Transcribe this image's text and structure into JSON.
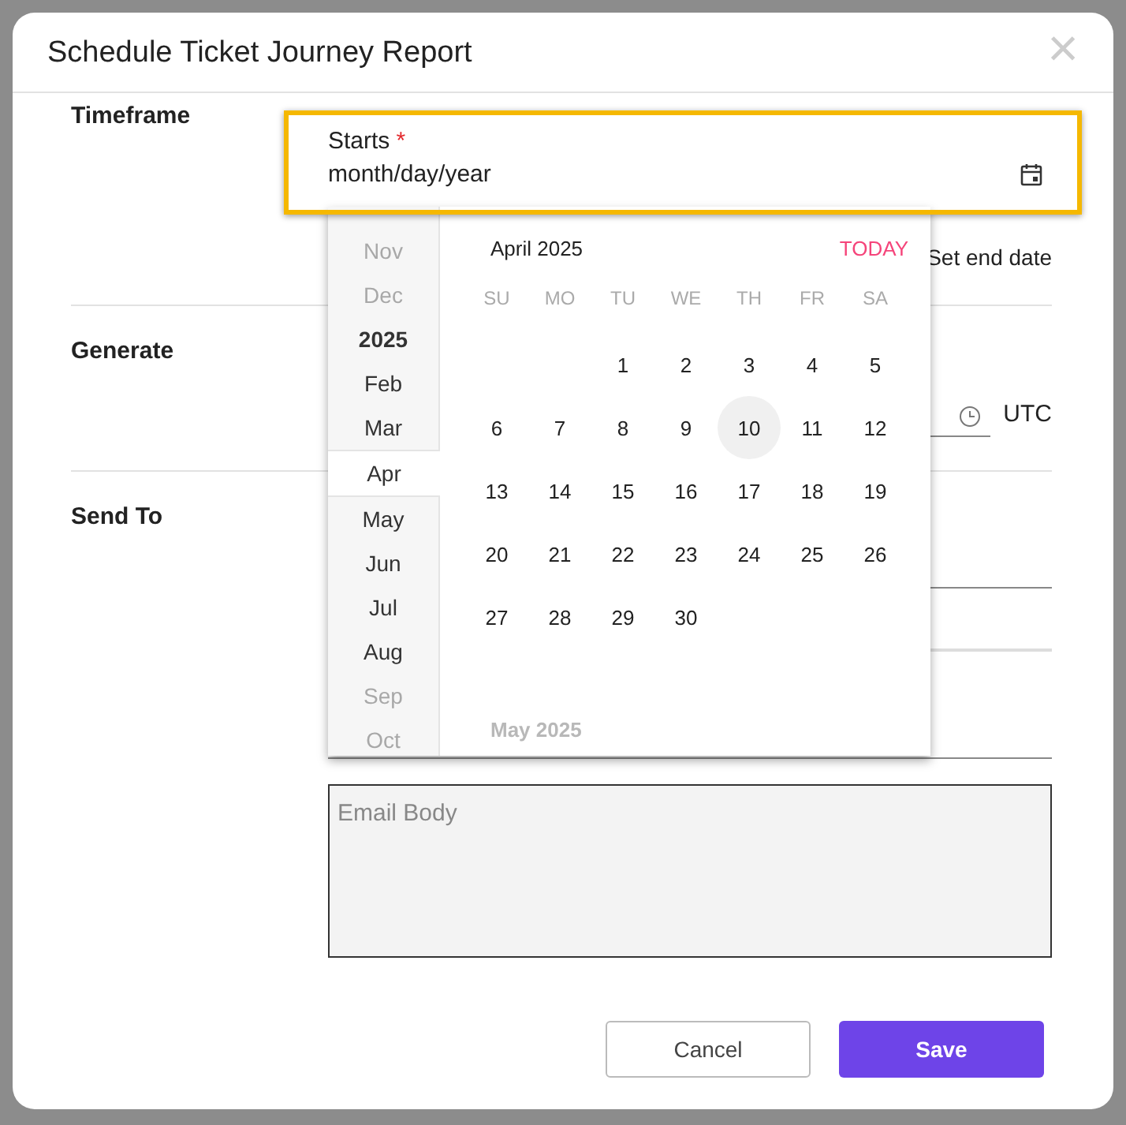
{
  "dialog": {
    "title": "Schedule Ticket Journey Report",
    "close": "×"
  },
  "sections": [
    {
      "label": "Timeframe"
    },
    {
      "label": "Generate"
    },
    {
      "label": "Send To"
    }
  ],
  "starts": {
    "label": "Starts",
    "required_mark": "*",
    "placeholder": "month/day/year",
    "focused": true
  },
  "end_date": {
    "label": "Set end date"
  },
  "time": {
    "zone": "UTC"
  },
  "email_body": {
    "placeholder": "Email Body"
  },
  "picker": {
    "month_title": "April 2025",
    "today": "TODAY",
    "next_month_title": "May 2025",
    "list": [
      {
        "text": "Nov",
        "kind": "month",
        "faded": true,
        "selected": false
      },
      {
        "text": "Dec",
        "kind": "month",
        "faded": true,
        "selected": false
      },
      {
        "text": "2025",
        "kind": "year",
        "faded": false,
        "selected": false
      },
      {
        "text": "Feb",
        "kind": "month",
        "faded": false,
        "selected": false
      },
      {
        "text": "Mar",
        "kind": "month",
        "faded": false,
        "selected": false
      },
      {
        "text": "Apr",
        "kind": "month",
        "faded": false,
        "selected": true
      },
      {
        "text": "May",
        "kind": "month",
        "faded": false,
        "selected": false
      },
      {
        "text": "Jun",
        "kind": "month",
        "faded": false,
        "selected": false
      },
      {
        "text": "Jul",
        "kind": "month",
        "faded": false,
        "selected": false
      },
      {
        "text": "Aug",
        "kind": "month",
        "faded": false,
        "selected": false
      },
      {
        "text": "Sep",
        "kind": "month",
        "faded": true,
        "selected": false
      },
      {
        "text": "Oct",
        "kind": "month",
        "faded": true,
        "selected": false
      }
    ],
    "weekdays": [
      "SU",
      "MO",
      "TU",
      "WE",
      "TH",
      "FR",
      "SA"
    ],
    "weeks": [
      [
        {
          "kind": "blank"
        },
        {
          "kind": "blank"
        },
        {
          "day": "1",
          "today": false
        },
        {
          "day": "2",
          "today": false
        },
        {
          "day": "3",
          "today": false
        },
        {
          "day": "4",
          "today": false
        },
        {
          "day": "5",
          "today": false
        }
      ],
      [
        {
          "day": "6",
          "today": false
        },
        {
          "day": "7",
          "today": false
        },
        {
          "day": "8",
          "today": false
        },
        {
          "day": "9",
          "today": false
        },
        {
          "day": "10",
          "today": true
        },
        {
          "day": "11",
          "today": false
        },
        {
          "day": "12",
          "today": false
        }
      ],
      [
        {
          "day": "13",
          "today": false
        },
        {
          "day": "14",
          "today": false
        },
        {
          "day": "15",
          "today": false
        },
        {
          "day": "16",
          "today": false
        },
        {
          "day": "17",
          "today": false
        },
        {
          "day": "18",
          "today": false
        },
        {
          "day": "19",
          "today": false
        }
      ],
      [
        {
          "day": "20",
          "today": false
        },
        {
          "day": "21",
          "today": false
        },
        {
          "day": "22",
          "today": false
        },
        {
          "day": "23",
          "today": false
        },
        {
          "day": "24",
          "today": false
        },
        {
          "day": "25",
          "today": false
        },
        {
          "day": "26",
          "today": false
        }
      ],
      [
        {
          "day": "27",
          "today": false
        },
        {
          "day": "28",
          "today": false
        },
        {
          "day": "29",
          "today": false
        },
        {
          "day": "30",
          "today": false
        },
        {
          "kind": "blank"
        },
        {
          "kind": "blank"
        },
        {
          "kind": "blank"
        }
      ]
    ]
  },
  "buttons": [
    {
      "label": "Cancel",
      "kind": "secondary"
    },
    {
      "label": "Save",
      "kind": "primary"
    }
  ]
}
